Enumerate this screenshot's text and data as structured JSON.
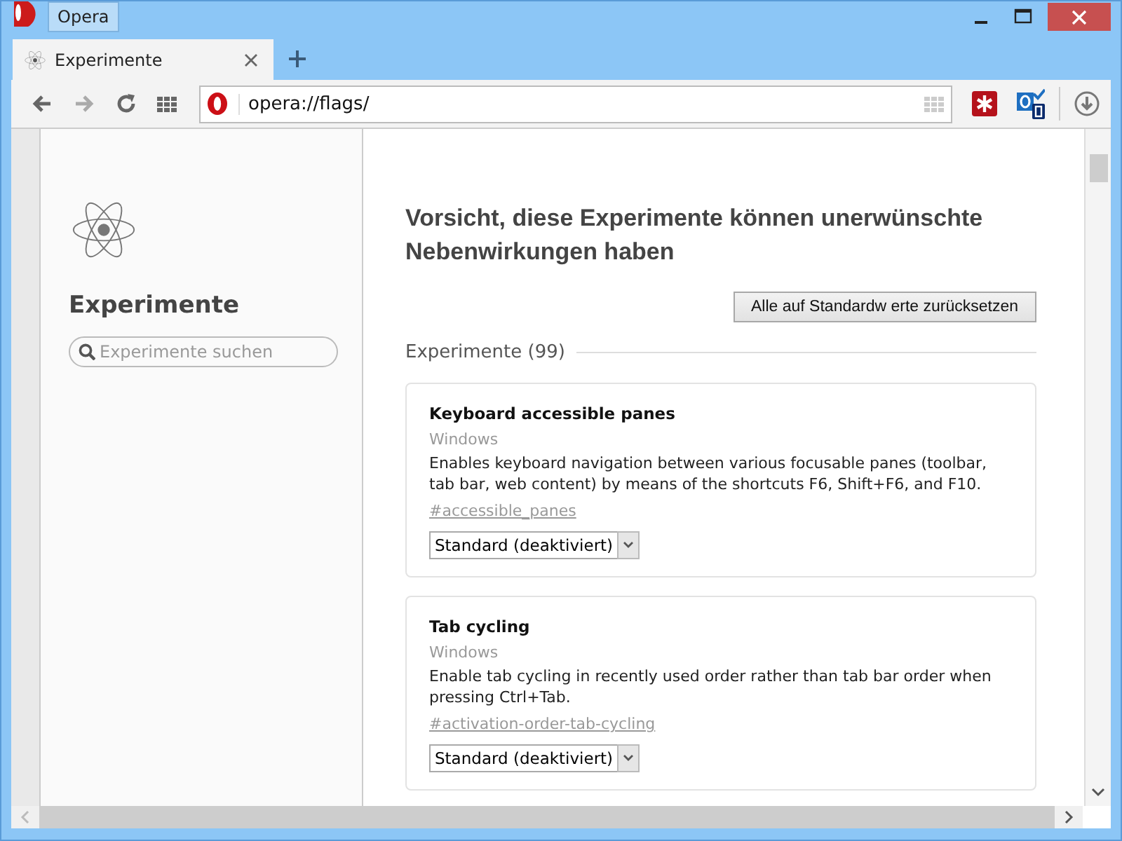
{
  "window": {
    "title": "Opera"
  },
  "tabs": [
    {
      "label": "Experimente",
      "selected": true
    }
  ],
  "address_bar": {
    "value": "opera://flags/"
  },
  "sidebar": {
    "title": "Experimente",
    "search": {
      "placeholder": "Experimente suchen"
    }
  },
  "main": {
    "heading": "Vorsicht, diese Experimente können unerwünschte Nebenwirkungen haben",
    "reset_button": "Alle auf Standardw erte zurücksetzen",
    "section_title": "Experimente (99)",
    "experiments": [
      {
        "name": "Keyboard accessible panes",
        "platform": "Windows",
        "description": "Enables keyboard navigation between various focusable panes (toolbar, tab bar, web content) by means of the shortcuts F6, Shift+F6, and F10.",
        "link": "#accessible_panes",
        "select_value": "Standard (deaktiviert)"
      },
      {
        "name": "Tab cycling",
        "platform": "Windows",
        "description": "Enable tab cycling in recently used order rather than tab bar order when pressing Ctrl+Tab.",
        "link": "#activation-order-tab-cycling",
        "select_value": "Standard (deaktiviert)"
      }
    ]
  }
}
